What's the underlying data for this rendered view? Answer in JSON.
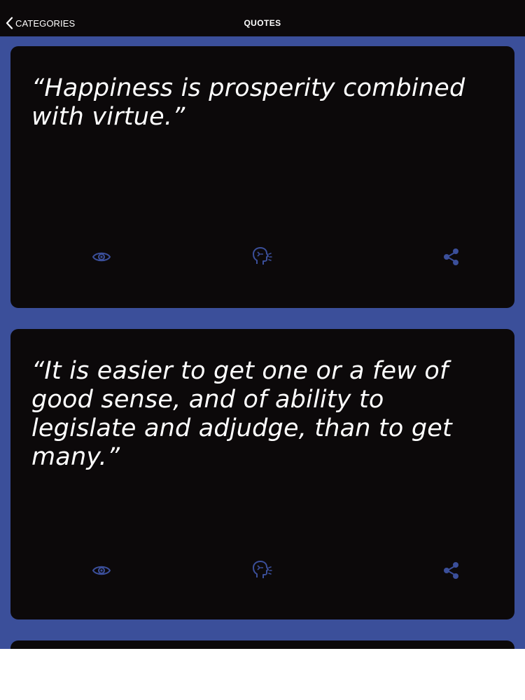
{
  "nav": {
    "back_label": "CATEGORIES",
    "title": "QUOTES"
  },
  "colors": {
    "background": "#3b4f9a",
    "card": "#0c090a",
    "icon": "#3b4f9a",
    "text": "#ffffff"
  },
  "quotes": [
    {
      "text": "“Happiness is prosperity combined with virtue.”",
      "actions": [
        "eye-icon",
        "speak-icon",
        "share-icon"
      ]
    },
    {
      "text": "“It is easier to get one or a few of good sense, and of ability to legislate and adjudge, than to get many.”",
      "actions": [
        "eye-icon",
        "speak-icon",
        "share-icon"
      ]
    }
  ]
}
